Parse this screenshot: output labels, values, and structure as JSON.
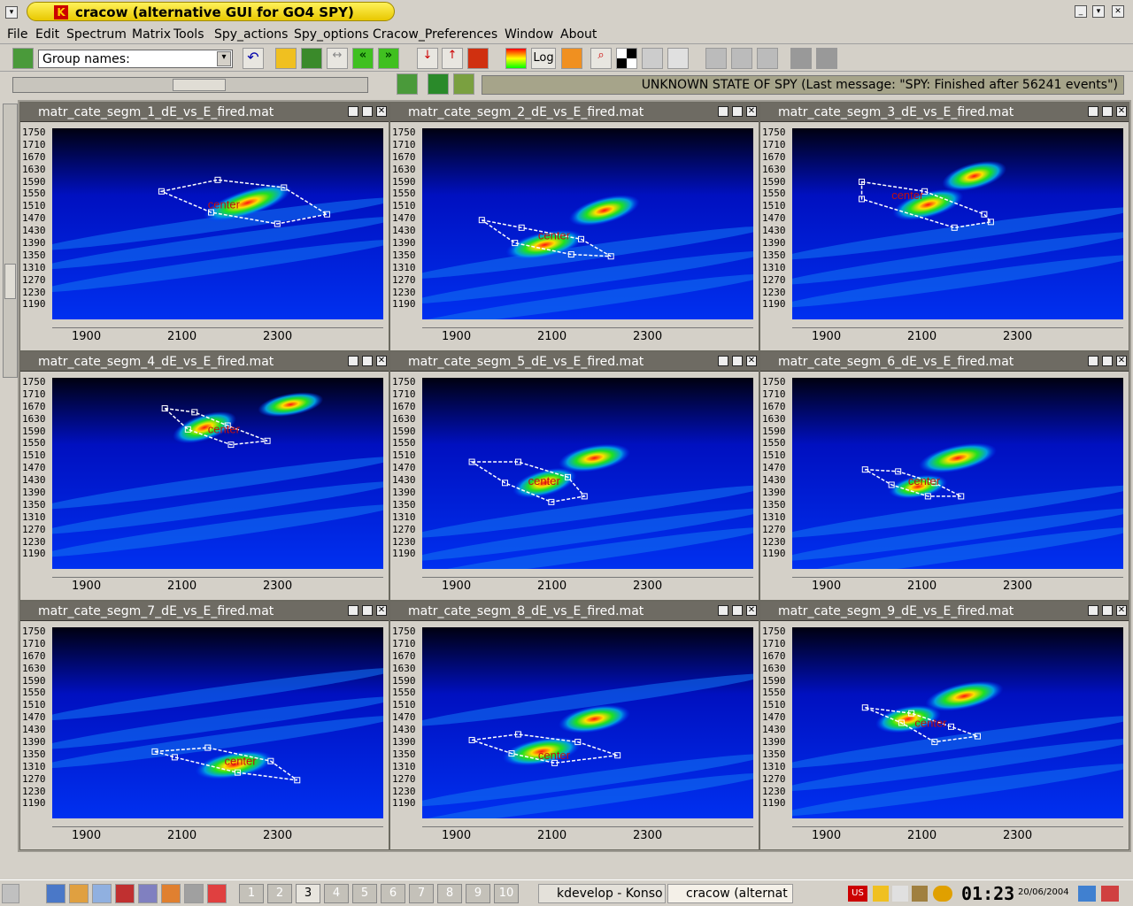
{
  "window": {
    "title": "cracow  (alternative GUI for GO4 SPY)",
    "logo": "K"
  },
  "menu": [
    "File",
    "Edit",
    "Spectrum",
    "Matrix",
    "Tools",
    "Spy_actions",
    "Spy_options",
    "Cracow_Preferences",
    "Window",
    "About"
  ],
  "toolbar": {
    "group_placeholder": "Group names:",
    "log_label": "Log",
    "icons": [
      "group-icon",
      "undo-icon",
      "zoom-icon",
      "histogram-icon",
      "arrows-icon",
      "prev-icon",
      "next-icon",
      "rebin-down-icon",
      "rebin-up-icon",
      "projection-icon",
      "color-icon",
      "log-icon",
      "spectrum-icon",
      "find-peak-icon",
      "palette-icon",
      "print-icon",
      "config-icon",
      "spy1-icon",
      "spy2-icon",
      "spy3-icon",
      "layout1-icon",
      "layout2-icon"
    ]
  },
  "status": {
    "text": "UNKNOWN STATE OF SPY (Last message: \"SPY: Finished after 56241 events\")"
  },
  "polygon_label": "center",
  "y_ticks": [
    "1750",
    "1710",
    "1670",
    "1630",
    "1590",
    "1550",
    "1510",
    "1470",
    "1430",
    "1390",
    "1350",
    "1310",
    "1270",
    "1230",
    "1190"
  ],
  "x_ticks": [
    "1900",
    "2100",
    "2300"
  ],
  "panels": [
    {
      "title": "matr_cate_segm_1_dE_vs_E_fired.mat"
    },
    {
      "title": "matr_cate_segm_2_dE_vs_E_fired.mat"
    },
    {
      "title": "matr_cate_segm_3_dE_vs_E_fired.mat"
    },
    {
      "title": "matr_cate_segm_4_dE_vs_E_fired.mat"
    },
    {
      "title": "matr_cate_segm_5_dE_vs_E_fired.mat"
    },
    {
      "title": "matr_cate_segm_6_dE_vs_E_fired.mat"
    },
    {
      "title": "matr_cate_segm_7_dE_vs_E_fired.mat"
    },
    {
      "title": "matr_cate_segm_8_dE_vs_E_fired.mat"
    },
    {
      "title": "matr_cate_segm_9_dE_vs_E_fired.mat"
    }
  ],
  "taskbar": {
    "desktops": [
      "1",
      "2",
      "3",
      "4",
      "5",
      "6",
      "7",
      "8",
      "9",
      "10"
    ],
    "tasks": [
      "kdevelop - Konso",
      "cracow  (alternat"
    ],
    "clock": "01:23",
    "date": "20/06/2004",
    "tray_label": "US"
  }
}
